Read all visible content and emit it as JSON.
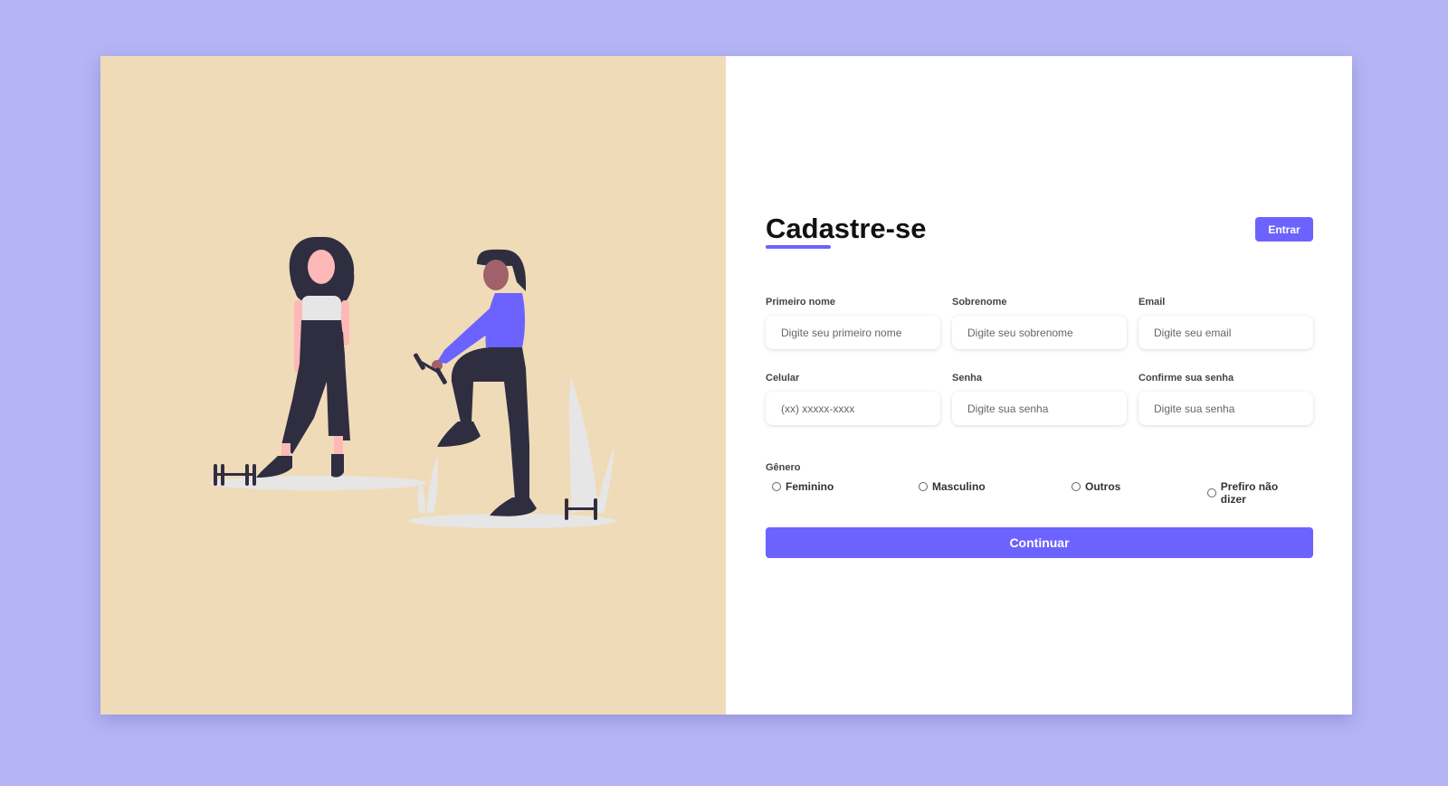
{
  "header": {
    "title": "Cadastre-se",
    "login_button": "Entrar"
  },
  "form": {
    "fields": [
      {
        "label": "Primeiro nome",
        "placeholder": "Digite seu primeiro nome",
        "value": ""
      },
      {
        "label": "Sobrenome",
        "placeholder": "Digite seu sobrenome",
        "value": ""
      },
      {
        "label": "Email",
        "placeholder": "Digite seu email",
        "value": ""
      },
      {
        "label": "Celular",
        "placeholder": "(xx) xxxxx-xxxx",
        "value": ""
      },
      {
        "label": "Senha",
        "placeholder": "Digite sua senha",
        "value": ""
      },
      {
        "label": "Confirme sua senha",
        "placeholder": "Digite sua senha",
        "value": ""
      }
    ],
    "gender": {
      "label": "Gênero",
      "options": [
        "Feminino",
        "Masculino",
        "Outros",
        "Prefiro não dizer"
      ]
    },
    "submit_label": "Continuar"
  },
  "colors": {
    "page_background": "#b5b5f5",
    "illustration_background": "#f0dbb8",
    "accent": "#6c63ff"
  },
  "illustration": {
    "icon": "fitness-women-illustration"
  }
}
